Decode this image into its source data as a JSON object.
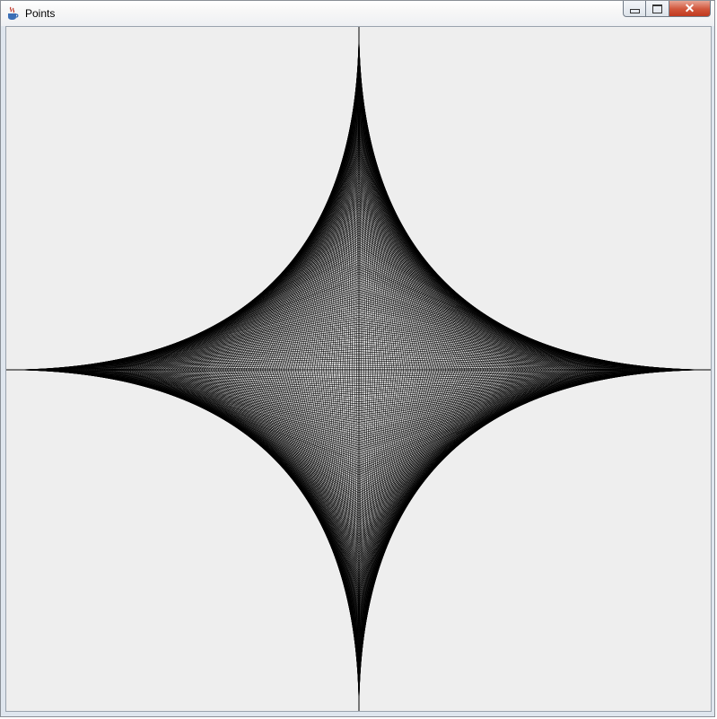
{
  "window": {
    "title": "Points",
    "icon": "java-cup-icon",
    "controls": [
      {
        "name": "minimize-button",
        "icon": "minimize-icon"
      },
      {
        "name": "maximize-button",
        "icon": "maximize-icon"
      },
      {
        "name": "close-button",
        "icon": "close-icon"
      }
    ]
  },
  "drawing": {
    "shape": "astroid envelope",
    "line_color": "#000000",
    "background": "#eeeeee",
    "line_count": 150
  }
}
